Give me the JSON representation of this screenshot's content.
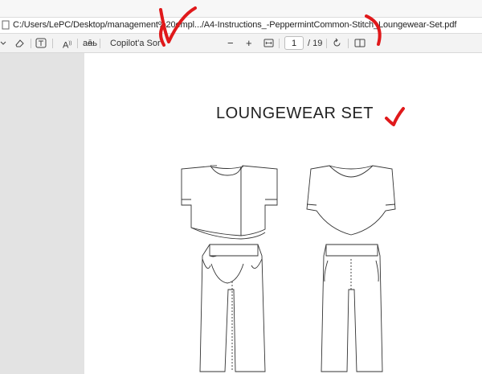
{
  "address_bar": {
    "url": "C:/Users/LePC/Desktop/management%20empl.../A4-Instructions_-PeppermintCommon-Stitch_Loungewear-Set.pdf"
  },
  "toolbar": {
    "copilot_label": "Copilot'a Sor",
    "zoom_out": "−",
    "zoom_in": "+",
    "current_page": "1",
    "page_total": "/ 19",
    "read_aloud_label": "A",
    "immersive_label": "a͡b"
  },
  "document": {
    "title": "LOUNGEWEAR SET"
  },
  "colors": {
    "annotation": "#e0191b",
    "page": "#ffffff",
    "viewer_bg": "#e3e3e3"
  },
  "icons": [
    "document-icon",
    "chevron-down-icon",
    "eraser-icon",
    "text-box-icon",
    "read-aloud-icon",
    "translate-icon",
    "zoom-out-icon",
    "zoom-in-icon",
    "fit-page-icon",
    "rotate-icon",
    "two-page-icon"
  ]
}
